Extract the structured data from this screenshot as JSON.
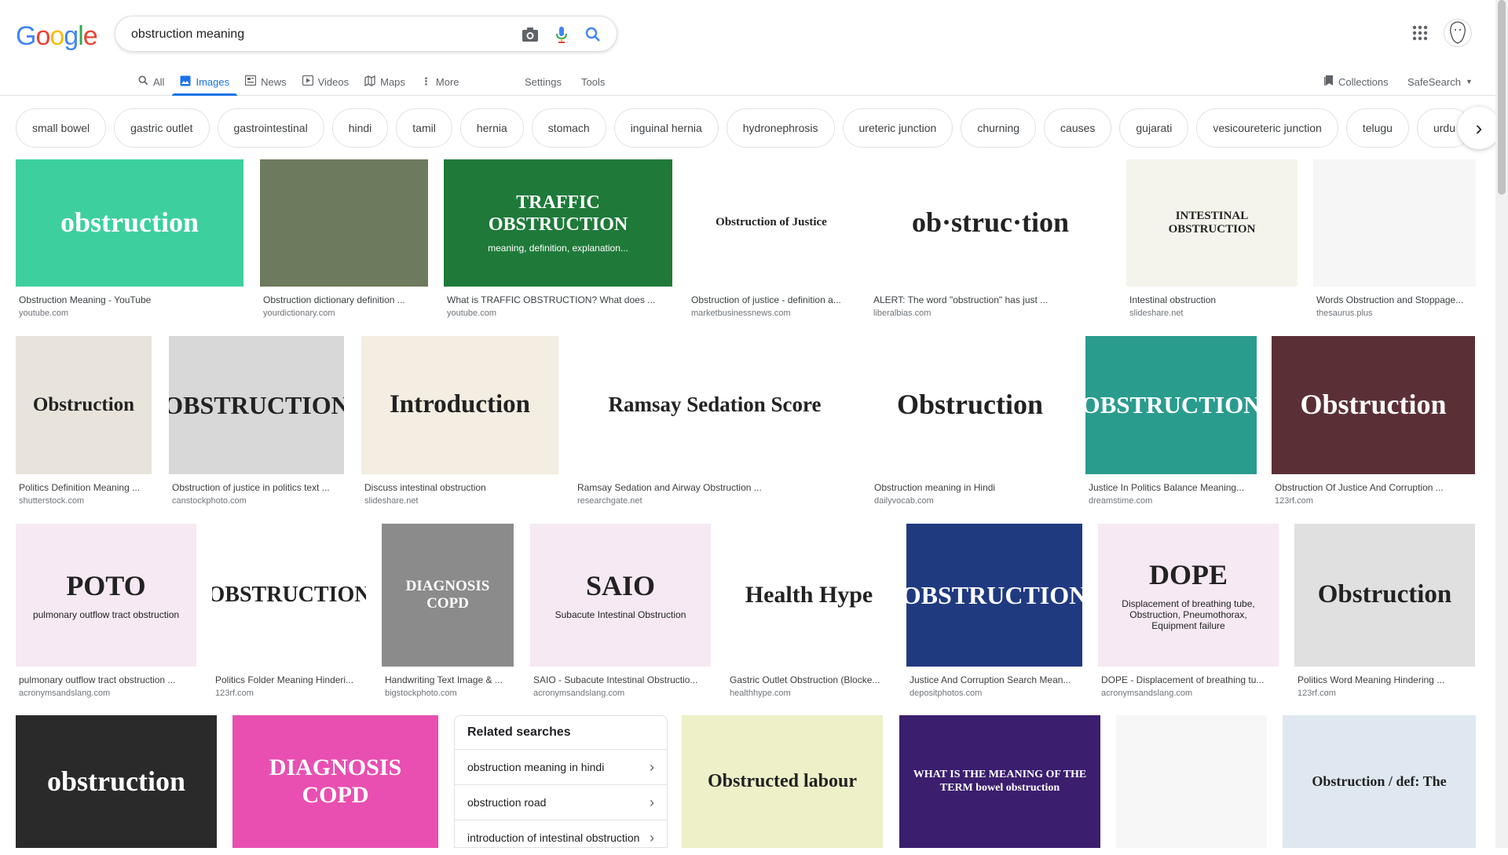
{
  "logo": "Google",
  "search": {
    "query": "obstruction meaning"
  },
  "tabs": [
    {
      "label": "All",
      "icon": "search-icon"
    },
    {
      "label": "Images",
      "icon": "image-icon",
      "active": true
    },
    {
      "label": "News",
      "icon": "news-icon"
    },
    {
      "label": "Videos",
      "icon": "video-icon"
    },
    {
      "label": "Maps",
      "icon": "map-pin-icon"
    },
    {
      "label": "More",
      "icon": "more-vert-icon"
    }
  ],
  "tools": {
    "settings": "Settings",
    "tools": "Tools",
    "collections": "Collections",
    "safesearch": "SafeSearch"
  },
  "chips": [
    "small bowel",
    "gastric outlet",
    "gastrointestinal",
    "hindi",
    "tamil",
    "hernia",
    "stomach",
    "inguinal hernia",
    "hydronephrosis",
    "ureteric junction",
    "churning",
    "causes",
    "gujarati",
    "vesicoureteric junction",
    "telugu",
    "urdu"
  ],
  "results_row1": [
    {
      "title": "Obstruction Meaning - YouTube",
      "source": "youtube.com",
      "thumb_text": "obstruction",
      "bg": "#3ecf9f"
    },
    {
      "title": "Obstruction dictionary definition ...",
      "source": "yourdictionary.com",
      "thumb_text": "",
      "bg": "#6d7a5e"
    },
    {
      "title": "What is TRAFFIC OBSTRUCTION? What does ...",
      "source": "youtube.com",
      "thumb_text": "TRAFFIC OBSTRUCTION",
      "thumb_sub": "meaning, definition, explanation...",
      "bg": "#1f7a3a"
    },
    {
      "title": "Obstruction of justice - definition a...",
      "source": "marketbusinessnews.com",
      "thumb_text": "Obstruction of Justice",
      "bg": "#ffffff"
    },
    {
      "title": "ALERT: The word \"obstruction\" has just ...",
      "source": "liberalbias.com",
      "thumb_text": "ob·struc·tion",
      "bg": "#ffffff"
    },
    {
      "title": "Intestinal obstruction",
      "source": "slideshare.net",
      "thumb_text": "INTESTINAL OBSTRUCTION",
      "bg": "#f4f4ec"
    },
    {
      "title": "Words Obstruction and Stoppage...",
      "source": "thesaurus.plus",
      "thumb_text": "",
      "bg": "#f6f6f6"
    }
  ],
  "results_row2": [
    {
      "title": "Politics Definition Meaning ...",
      "source": "shutterstock.com",
      "thumb_text": "Obstruction",
      "bg": "#e8e4dc"
    },
    {
      "title": "Obstruction of justice in politics text ...",
      "source": "canstockphoto.com",
      "thumb_text": "OBSTRUCTION",
      "bg": "#d8d8d8"
    },
    {
      "title": "Discuss intestinal obstruction",
      "source": "slideshare.net",
      "thumb_text": "Introduction",
      "bg": "#f3ede2"
    },
    {
      "title": "Ramsay Sedation and Airway Obstruction ...",
      "source": "researchgate.net",
      "thumb_text": "Ramsay Sedation Score",
      "bg": "#ffffff"
    },
    {
      "title": "Obstruction meaning in Hindi",
      "source": "dailyvocab.com",
      "thumb_text": "Obstruction",
      "bg": "#ffffff"
    },
    {
      "title": "Justice In Politics Balance Meaning...",
      "source": "dreamstime.com",
      "thumb_text": "OBSTRUCTION",
      "bg": "#2a9c8e"
    },
    {
      "title": "Obstruction Of Justice And Corruption ...",
      "source": "123rf.com",
      "thumb_text": "Obstruction",
      "bg": "#5a3036"
    }
  ],
  "results_row3": [
    {
      "title": "pulmonary outflow tract obstruction ...",
      "source": "acronymsandslang.com",
      "thumb_text": "POTO",
      "thumb_sub": "pulmonary outflow tract obstruction",
      "bg": "#f6e9f3"
    },
    {
      "title": "Politics Folder Meaning Hinderi...",
      "source": "123rf.com",
      "thumb_text": "OBSTRUCTION",
      "bg": "#ffffff"
    },
    {
      "title": "Handwriting Text Image & ...",
      "source": "bigstockphoto.com",
      "thumb_text": "DIAGNOSIS COPD",
      "bg": "#8b8b8b"
    },
    {
      "title": "SAIO - Subacute Intestinal Obstructio...",
      "source": "acronymsandslang.com",
      "thumb_text": "SAIO",
      "thumb_sub": "Subacute Intestinal Obstruction",
      "bg": "#f6e9f3"
    },
    {
      "title": "Gastric Outlet Obstruction (Blocke...",
      "source": "healthhype.com",
      "thumb_text": "Health Hype",
      "bg": "#ffffff"
    },
    {
      "title": "Justice And Corruption Search Mean...",
      "source": "depositphotos.com",
      "thumb_text": "OBSTRUCTION",
      "bg": "#203a80"
    },
    {
      "title": "DOPE - Displacement of breathing tu...",
      "source": "acronymsandslang.com",
      "thumb_text": "DOPE",
      "thumb_sub": "Displacement of breathing tube, Obstruction, Pneumothorax, Equipment failure",
      "bg": "#f6e9f3"
    },
    {
      "title": "Politics Word Meaning Hindering ...",
      "source": "123rf.com",
      "thumb_text": "Obstruction",
      "bg": "#e0e0e0"
    }
  ],
  "results_row4": [
    {
      "thumb_text": "obstruction",
      "bg": "#2a2a2a"
    },
    {
      "thumb_text": "DIAGNOSIS COPD",
      "bg": "#e84fb0"
    },
    {
      "thumb_text": "Obstructed labour",
      "bg": "#eef0c8"
    },
    {
      "thumb_text": "WHAT IS THE MEANING OF THE TERM bowel obstruction",
      "bg": "#3b1e6e"
    },
    {
      "thumb_text": "",
      "bg": "#f7f7f7"
    },
    {
      "thumb_text": "Obstruction / def: The",
      "bg": "#dfe8f0"
    }
  ],
  "related": {
    "heading": "Related searches",
    "items": [
      "obstruction meaning in hindi",
      "obstruction road",
      "introduction of intestinal obstruction"
    ]
  }
}
